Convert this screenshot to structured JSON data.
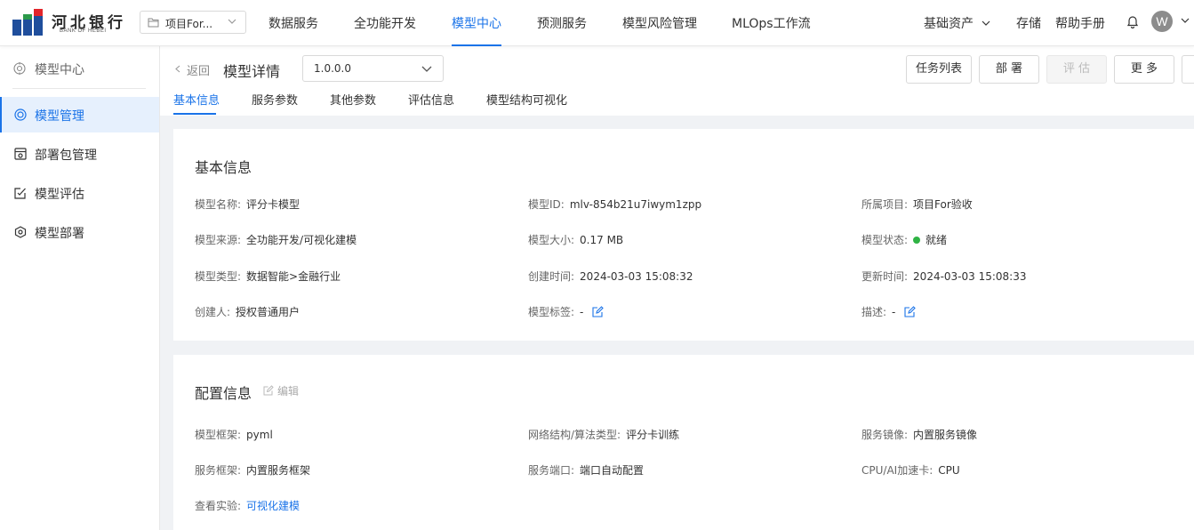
{
  "brand": {
    "name_cn": "河北银行",
    "name_en": "BANK OF HEBEI",
    "logo_colors": [
      "#1f4e9c",
      "#e2262b",
      "#2c9a4a"
    ]
  },
  "project_selector": {
    "value": "项目For...",
    "icon": "folder-icon"
  },
  "top_nav": {
    "items": [
      {
        "label": "数据服务"
      },
      {
        "label": "全功能开发"
      },
      {
        "label": "模型中心",
        "active": true
      },
      {
        "label": "预测服务"
      },
      {
        "label": "模型风险管理"
      },
      {
        "label": "MLOps工作流"
      }
    ],
    "right": {
      "assets": "基础资产",
      "storage": "存储",
      "help": "帮助手册",
      "avatar_letter": "W"
    }
  },
  "sidebar": {
    "title": "模型中心",
    "items": [
      {
        "label": "模型管理",
        "icon": "model-icon",
        "active": true
      },
      {
        "label": "部署包管理",
        "icon": "package-icon"
      },
      {
        "label": "模型评估",
        "icon": "evaluate-icon"
      },
      {
        "label": "模型部署",
        "icon": "deploy-icon"
      }
    ]
  },
  "header": {
    "back": "返回",
    "title": "模型详情",
    "version": "1.0.0.0",
    "buttons": {
      "tasks": "任务列表",
      "deploy": "部 署",
      "evaluate": "评 估",
      "more": "更 多"
    }
  },
  "tabs": [
    {
      "label": "基本信息",
      "active": true
    },
    {
      "label": "服务参数"
    },
    {
      "label": "其他参数"
    },
    {
      "label": "评估信息"
    },
    {
      "label": "模型结构可视化"
    }
  ],
  "basic_info": {
    "title": "基本信息",
    "model_name": {
      "label": "模型名称:",
      "value": "评分卡模型"
    },
    "model_id": {
      "label": "模型ID:",
      "value": "mlv-854b21u7iwym1zpp"
    },
    "project": {
      "label": "所属项目:",
      "value": "项目For验收"
    },
    "source": {
      "label": "模型来源:",
      "value": "全功能开发/可视化建模"
    },
    "size": {
      "label": "模型大小:",
      "value": "0.17 MB"
    },
    "status": {
      "label": "模型状态:",
      "value": "就绪",
      "color": "#2fb344"
    },
    "type": {
      "label": "模型类型:",
      "value": "数据智能>金融行业"
    },
    "created": {
      "label": "创建时间:",
      "value": "2024-03-03 15:08:32"
    },
    "updated": {
      "label": "更新时间:",
      "value": "2024-03-03 15:08:33"
    },
    "creator": {
      "label": "创建人:",
      "value": "授权普通用户"
    },
    "tags": {
      "label": "模型标签:",
      "value": "-"
    },
    "description": {
      "label": "描述:",
      "value": "-"
    }
  },
  "config_info": {
    "title": "配置信息",
    "edit": "编辑",
    "framework": {
      "label": "模型框架:",
      "value": "pyml"
    },
    "network": {
      "label": "网络结构/算法类型:",
      "value": "评分卡训练"
    },
    "image": {
      "label": "服务镜像:",
      "value": "内置服务镜像"
    },
    "service_framework": {
      "label": "服务框架:",
      "value": "内置服务框架"
    },
    "port": {
      "label": "服务端口:",
      "value": "端口自动配置"
    },
    "accelerator": {
      "label": "CPU/AI加速卡:",
      "value": "CPU"
    },
    "experiment": {
      "label": "查看实验:",
      "value": "可视化建模"
    }
  }
}
